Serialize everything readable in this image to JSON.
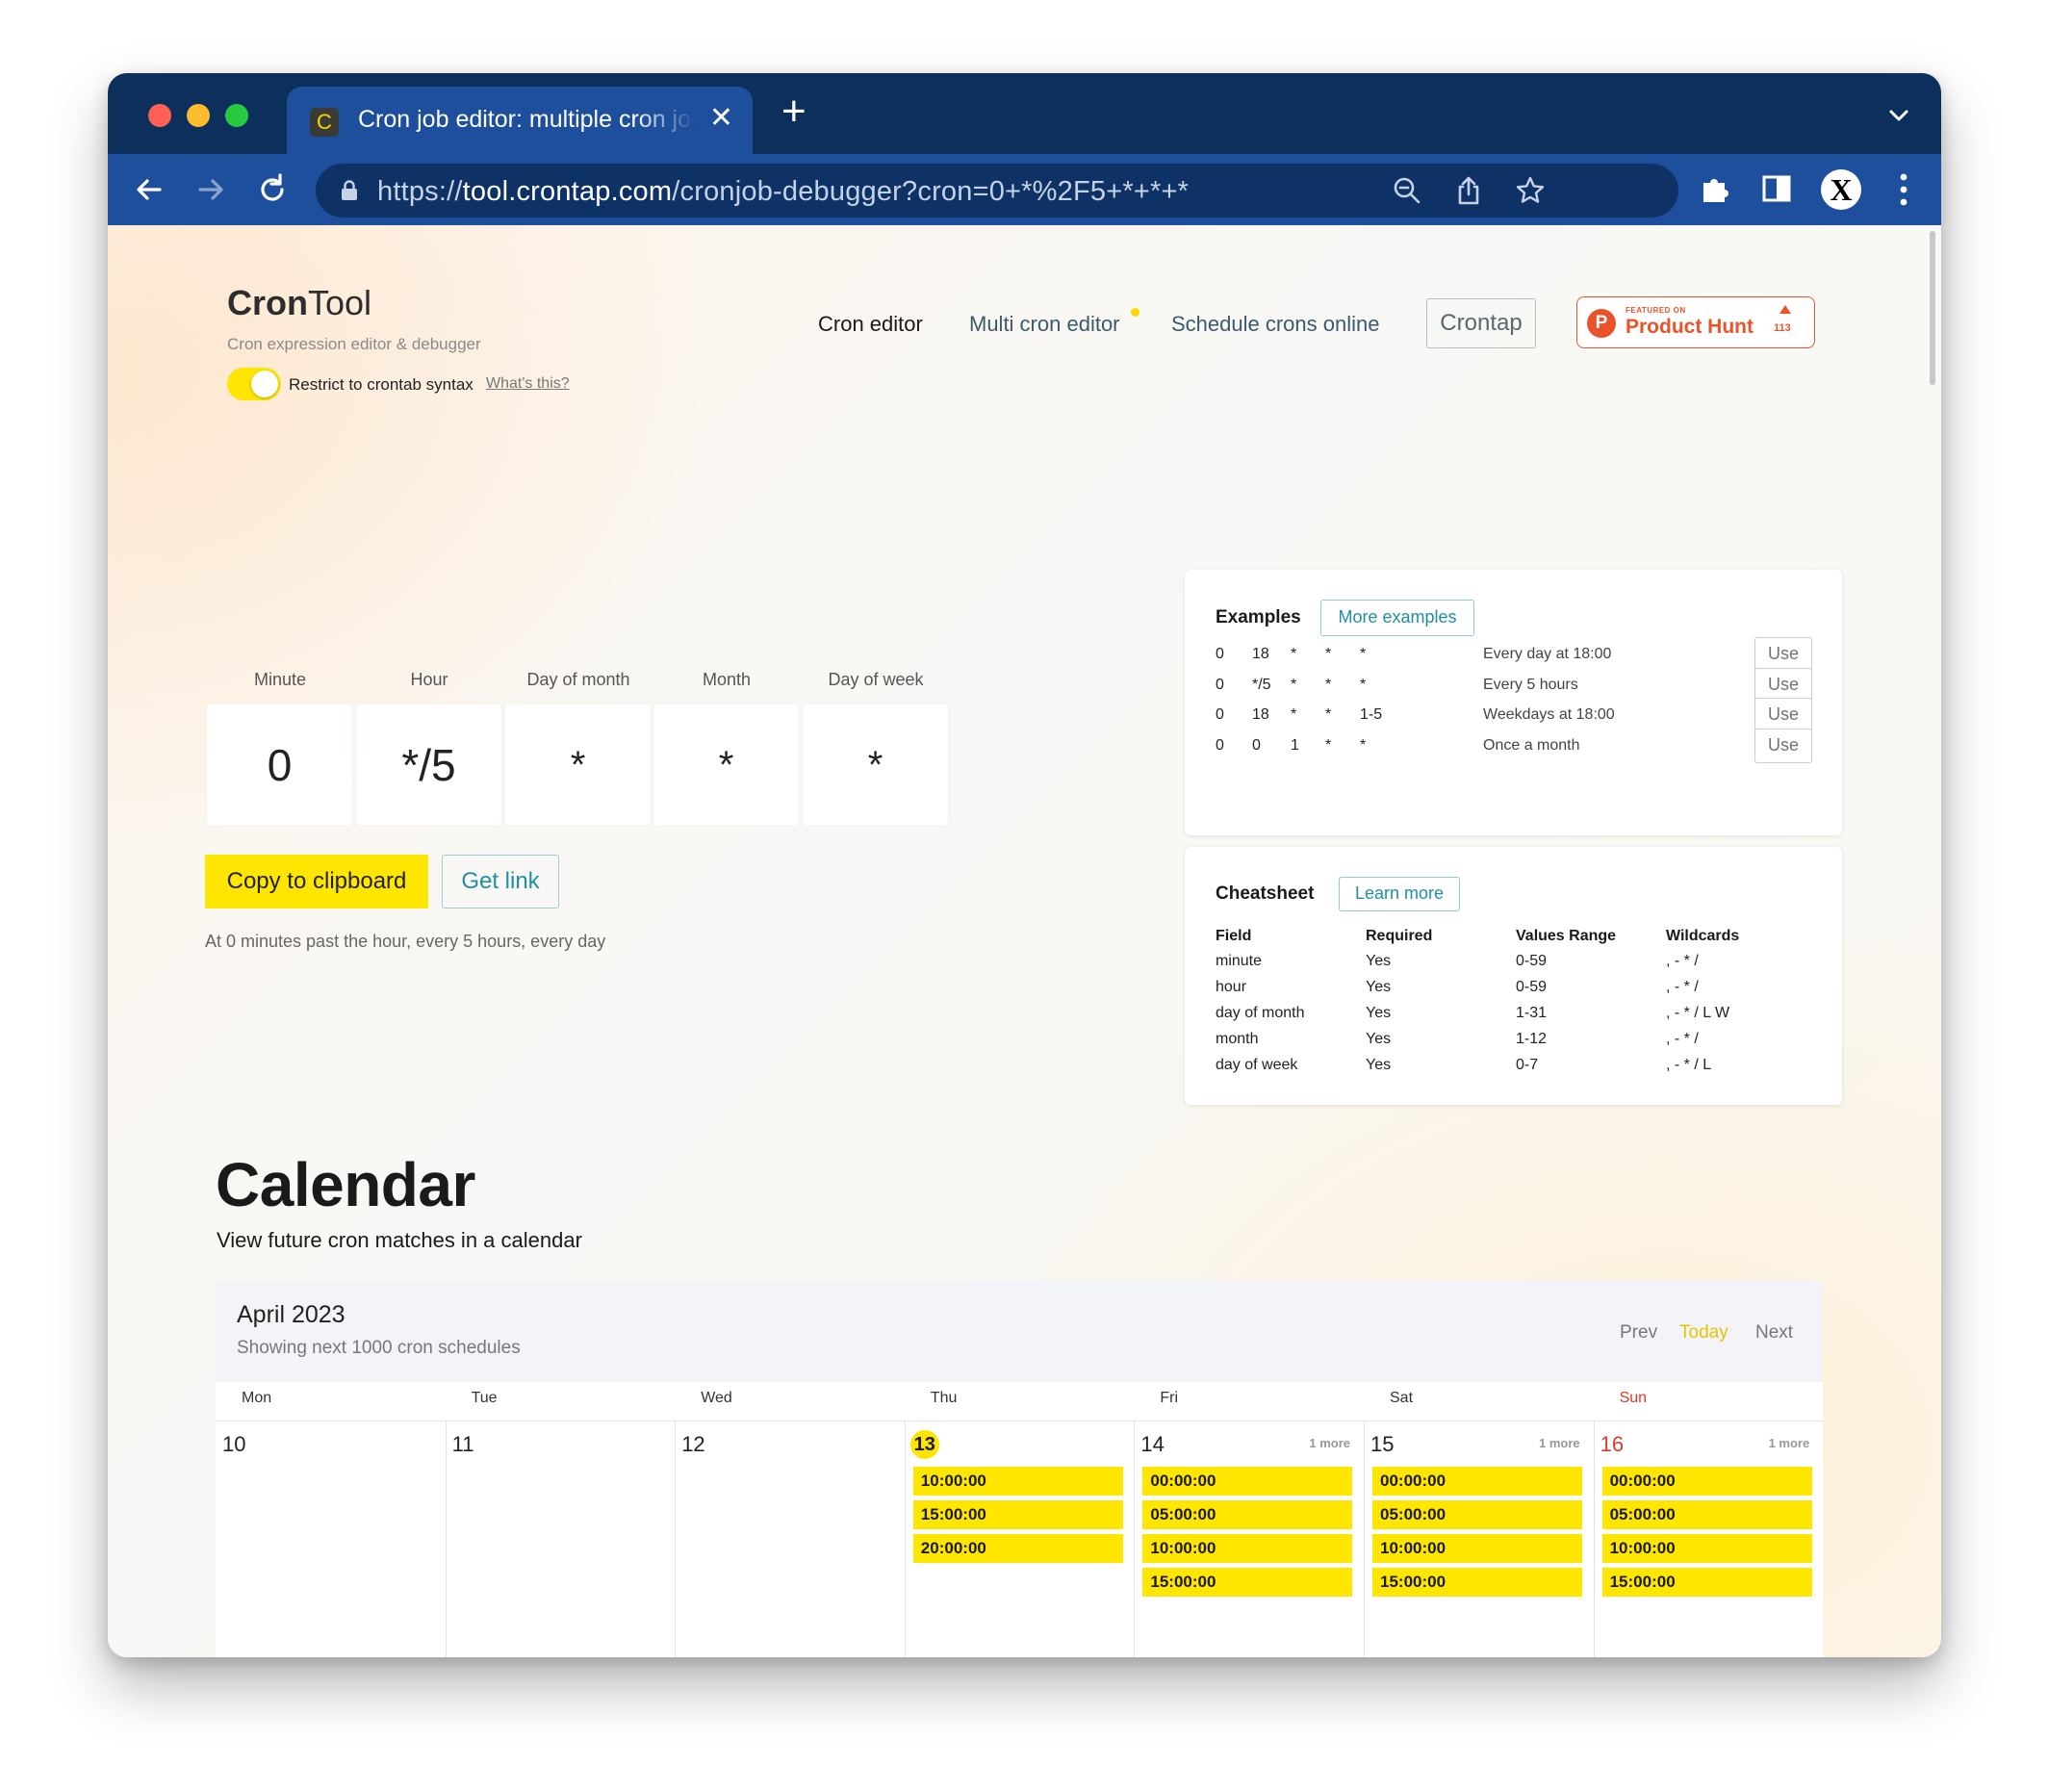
{
  "browser": {
    "tab_favicon": "C",
    "tab_title": "Cron job editor: multiple cron jobs",
    "url_scheme": "https://",
    "url_host": "tool.crontap.com",
    "url_path": "/cronjob-debugger?cron=0+*%2F5+*+*+*",
    "profile_initial": "X"
  },
  "header": {
    "brand_bold": "Cron",
    "brand_rest": "Tool",
    "brand_sub": "Cron expression editor & debugger",
    "toggle_label": "Restrict to crontab syntax",
    "toggle_help": "What's this?",
    "toggle_on": true,
    "nav": [
      "Cron editor",
      "Multi cron editor",
      "Schedule crons online"
    ],
    "crontap_button": "Crontap",
    "ph_small": "FEATURED ON",
    "ph_name": "Product Hunt",
    "ph_count": "113"
  },
  "editor": {
    "labels": [
      "Minute",
      "Hour",
      "Day of month",
      "Month",
      "Day of week"
    ],
    "values": [
      "0",
      "*/5",
      "*",
      "*",
      "*"
    ],
    "copy_button": "Copy to clipboard",
    "link_button": "Get link",
    "description": "At 0 minutes past the hour, every 5 hours, every day"
  },
  "examples": {
    "title": "Examples",
    "more_button": "More examples",
    "use_label": "Use",
    "rows": [
      {
        "fields": [
          "0",
          "18",
          "*",
          "*",
          "*"
        ],
        "desc": "Every day at 18:00"
      },
      {
        "fields": [
          "0",
          "*/5",
          "*",
          "*",
          "*"
        ],
        "desc": "Every 5 hours"
      },
      {
        "fields": [
          "0",
          "18",
          "*",
          "*",
          "1-5"
        ],
        "desc": "Weekdays at 18:00"
      },
      {
        "fields": [
          "0",
          "0",
          "1",
          "*",
          "*"
        ],
        "desc": "Once a month"
      }
    ]
  },
  "cheatsheet": {
    "title": "Cheatsheet",
    "learn_button": "Learn more",
    "headers": [
      "Field",
      "Required",
      "Values Range",
      "Wildcards"
    ],
    "rows": [
      [
        "minute",
        "Yes",
        "0-59",
        ", - * /"
      ],
      [
        "hour",
        "Yes",
        "0-59",
        ", - * /"
      ],
      [
        "day of month",
        "Yes",
        "1-31",
        ", - * / L W"
      ],
      [
        "month",
        "Yes",
        "1-12",
        ", - * /"
      ],
      [
        "day of week",
        "Yes",
        "0-7",
        ", - * / L"
      ]
    ]
  },
  "calendar": {
    "title": "Calendar",
    "subtitle": "View future cron matches in a calendar",
    "month": "April 2023",
    "count_text": "Showing next 1000 cron schedules",
    "nav": [
      "Prev",
      "Today",
      "Next"
    ],
    "days": [
      {
        "dow": "Mon",
        "num": "10",
        "more": "",
        "events": []
      },
      {
        "dow": "Tue",
        "num": "11",
        "more": "",
        "events": []
      },
      {
        "dow": "Wed",
        "num": "12",
        "more": "",
        "events": []
      },
      {
        "dow": "Thu",
        "num": "13",
        "more": "",
        "today": true,
        "events": [
          "10:00:00",
          "15:00:00",
          "20:00:00"
        ]
      },
      {
        "dow": "Fri",
        "num": "14",
        "more": "1 more",
        "events": [
          "00:00:00",
          "05:00:00",
          "10:00:00",
          "15:00:00"
        ]
      },
      {
        "dow": "Sat",
        "num": "15",
        "more": "1 more",
        "events": [
          "00:00:00",
          "05:00:00",
          "10:00:00",
          "15:00:00"
        ]
      },
      {
        "dow": "Sun",
        "num": "16",
        "more": "1 more",
        "sunday": true,
        "events": [
          "00:00:00",
          "05:00:00",
          "10:00:00",
          "15:00:00"
        ]
      }
    ]
  },
  "colors": {
    "accent_yellow": "#ffe600",
    "teal": "#1f8fa6",
    "product_hunt": "#ea532a",
    "sunday_red": "#e03a2e",
    "chrome_blue": "#1d4f9c"
  }
}
